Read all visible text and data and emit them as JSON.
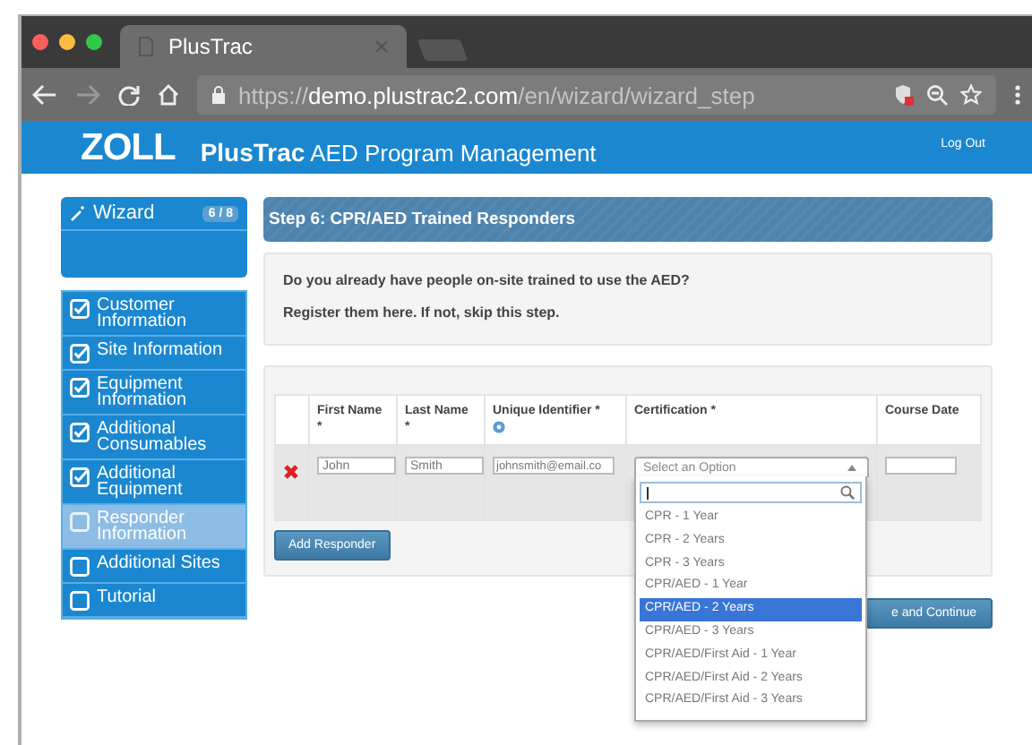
{
  "browser": {
    "tab_title": "PlusTrac",
    "url": {
      "scheme": "https://",
      "host": "demo.plustrac2.com",
      "path": "/en/wizard/wizard_step"
    }
  },
  "header": {
    "logo": "ZOLL",
    "brand": "PlusTrac",
    "subtitle": "AED Program Management",
    "logout": "Log Out"
  },
  "sidebar": {
    "title": "Wizard",
    "progress": "6 / 8",
    "steps": [
      {
        "label": "Customer Information",
        "checked": true,
        "selected": false
      },
      {
        "label": "Site Information",
        "checked": true,
        "selected": false
      },
      {
        "label": "Equipment Information",
        "checked": true,
        "selected": false
      },
      {
        "label": "Additional Consumables",
        "checked": true,
        "selected": false
      },
      {
        "label": "Additional Equipment",
        "checked": true,
        "selected": false
      },
      {
        "label": "Responder Information",
        "checked": false,
        "selected": true
      },
      {
        "label": "Additional Sites",
        "checked": false,
        "selected": false
      },
      {
        "label": "Tutorial",
        "checked": false,
        "selected": false
      }
    ]
  },
  "step_title": "Step 6: CPR/AED Trained Responders",
  "intro": [
    "Do you already have people on-site trained to use the AED?",
    "Register them here. If not, skip this step."
  ],
  "table": {
    "columns": [
      {
        "label": "First Name *",
        "help": false
      },
      {
        "label": "Last Name *",
        "help": false
      },
      {
        "label": "Unique Identifier *",
        "help": true
      },
      {
        "label": "Certification *",
        "help": false
      },
      {
        "label": "Course Date",
        "help": false
      }
    ],
    "rows": [
      {
        "first_name": "John",
        "last_name": "Smith",
        "identifier": "johnsmith@email.co",
        "certification": {
          "placeholder": "Select an Option",
          "open": true,
          "options": [
            {
              "label": "CPR - 1 Year",
              "selected": false
            },
            {
              "label": "CPR - 2 Years",
              "selected": false
            },
            {
              "label": "CPR - 3 Years",
              "selected": false
            },
            {
              "label": "CPR/AED - 1 Year",
              "selected": false
            },
            {
              "label": "CPR/AED - 2 Years",
              "selected": true
            },
            {
              "label": "CPR/AED - 3 Years",
              "selected": false
            },
            {
              "label": "CPR/AED/First Aid - 1 Year",
              "selected": false
            },
            {
              "label": "CPR/AED/First Aid - 2 Years",
              "selected": false
            },
            {
              "label": "CPR/AED/First Aid - 3 Years",
              "selected": false
            }
          ]
        }
      }
    ]
  },
  "add_button": "Add Responder",
  "continue_button": "e and Continue"
}
